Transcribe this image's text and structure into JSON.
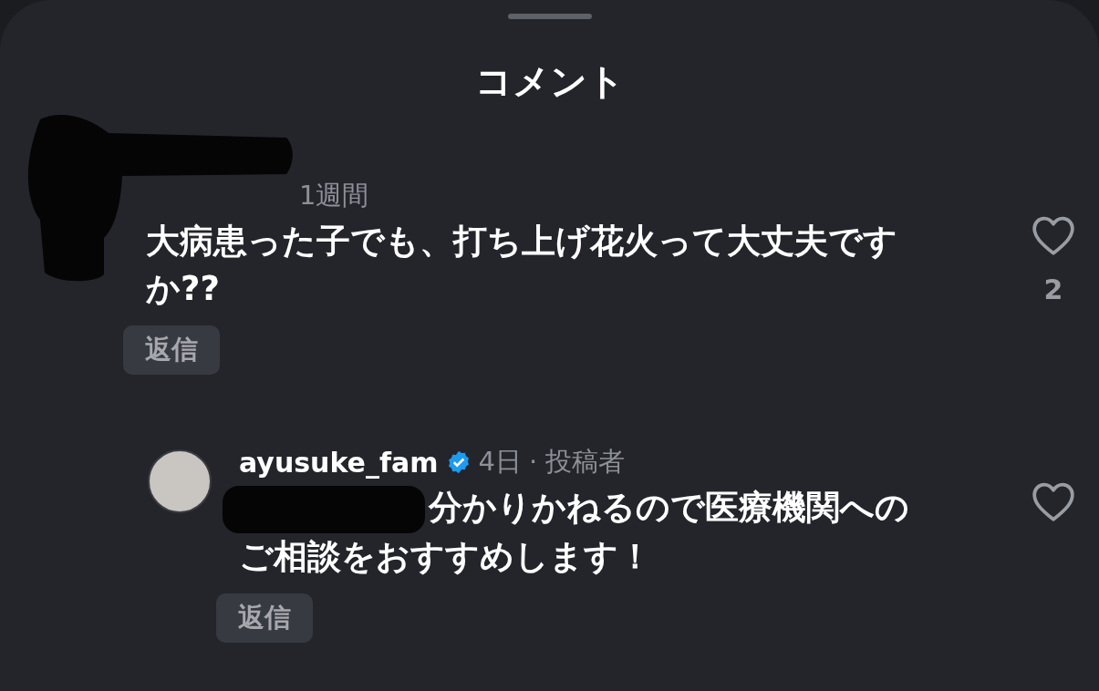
{
  "sheet": {
    "title": "コメント"
  },
  "comments": [
    {
      "redacted": true,
      "verified": false,
      "time": "1週間",
      "mention_redacted": false,
      "text": "大病患った子でも、打ち上げ花火って大丈夫ですか??",
      "liked": false,
      "like_count": "2",
      "reply_label": "返信",
      "replies": [
        {
          "username": "ayusuke_fam",
          "redacted": false,
          "verified": true,
          "time": "4日",
          "badge": "· 投稿者",
          "mention_redacted": true,
          "text": "分かりかねるので医療機関へのご相談をおすすめします！",
          "liked": false,
          "reply_label": "返信"
        }
      ]
    }
  ]
}
